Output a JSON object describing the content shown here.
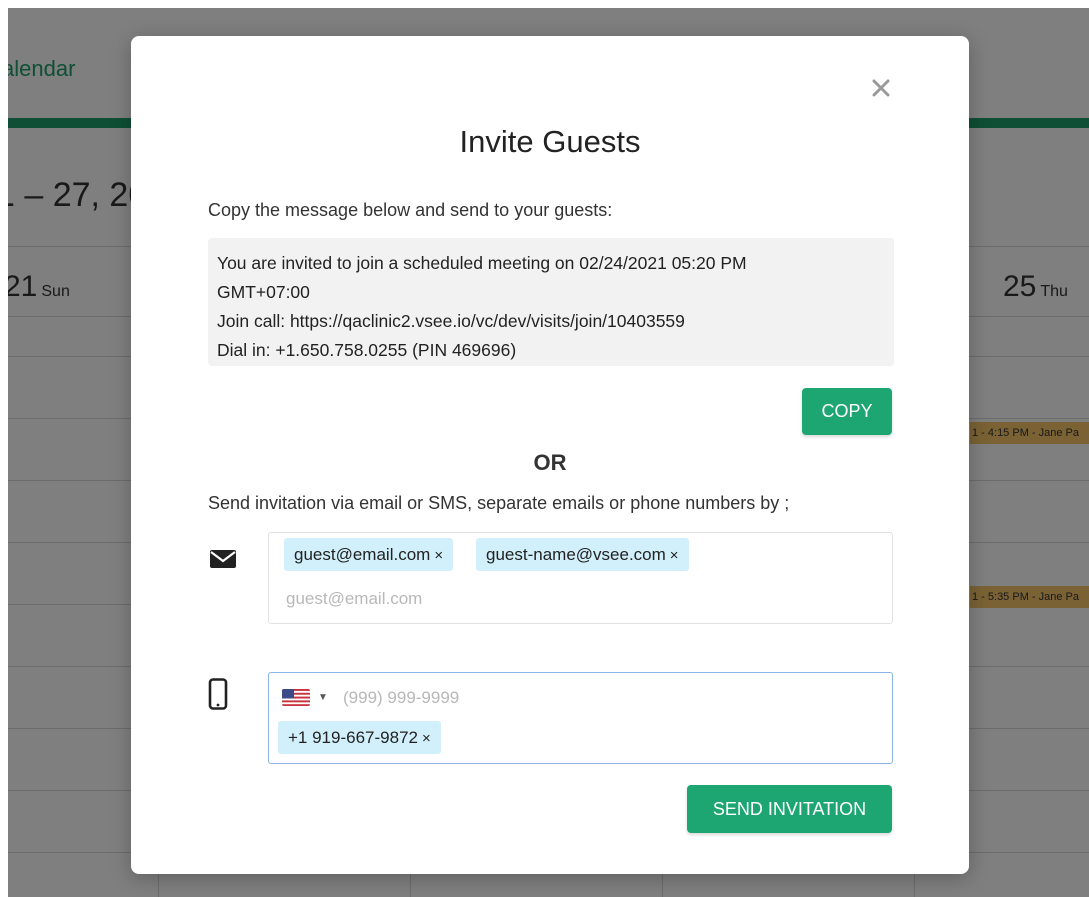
{
  "background": {
    "calendar_title": "alendar",
    "date_range": "1 – 27, 20",
    "days": [
      {
        "num": "21",
        "label": "Sun"
      },
      {
        "num": "25",
        "label": "Thu"
      }
    ],
    "events": [
      "1 - 4:15 PM - Jane Pa",
      "1 - 5:35 PM - Jane Pa"
    ],
    "accent_color": "#1e9e6a",
    "event_color": "#f5c46a"
  },
  "modal": {
    "title": "Invite Guests",
    "close_icon": "close-icon",
    "copy_instruction": "Copy the message below and send to your guests:",
    "message_lines": [
      "You are invited to join a scheduled meeting on 02/24/2021 05:20 PM",
      "GMT+07:00",
      "Join call: https://qaclinic2.vsee.io/vc/dev/visits/join/10403559",
      "Dial in: +1.650.758.0255 (PIN 469696)"
    ],
    "copy_button": "COPY",
    "or_label": "OR",
    "send_instruction": "Send invitation via email or SMS, separate emails or phone numbers by ;",
    "email": {
      "icon": "envelope-icon",
      "tags": [
        "guest@email.com",
        "guest-name@vsee.com"
      ],
      "placeholder": "guest@email.com"
    },
    "phone": {
      "icon": "mobile-phone-icon",
      "country_flag": "us-flag-icon",
      "placeholder": "(999) 999-9999",
      "tags": [
        "+1 919-667-9872"
      ]
    },
    "send_button": "SEND INVITATION",
    "tag_remove_glyph": "×",
    "button_color": "#1ea672",
    "tag_color": "#d2f0fb"
  }
}
